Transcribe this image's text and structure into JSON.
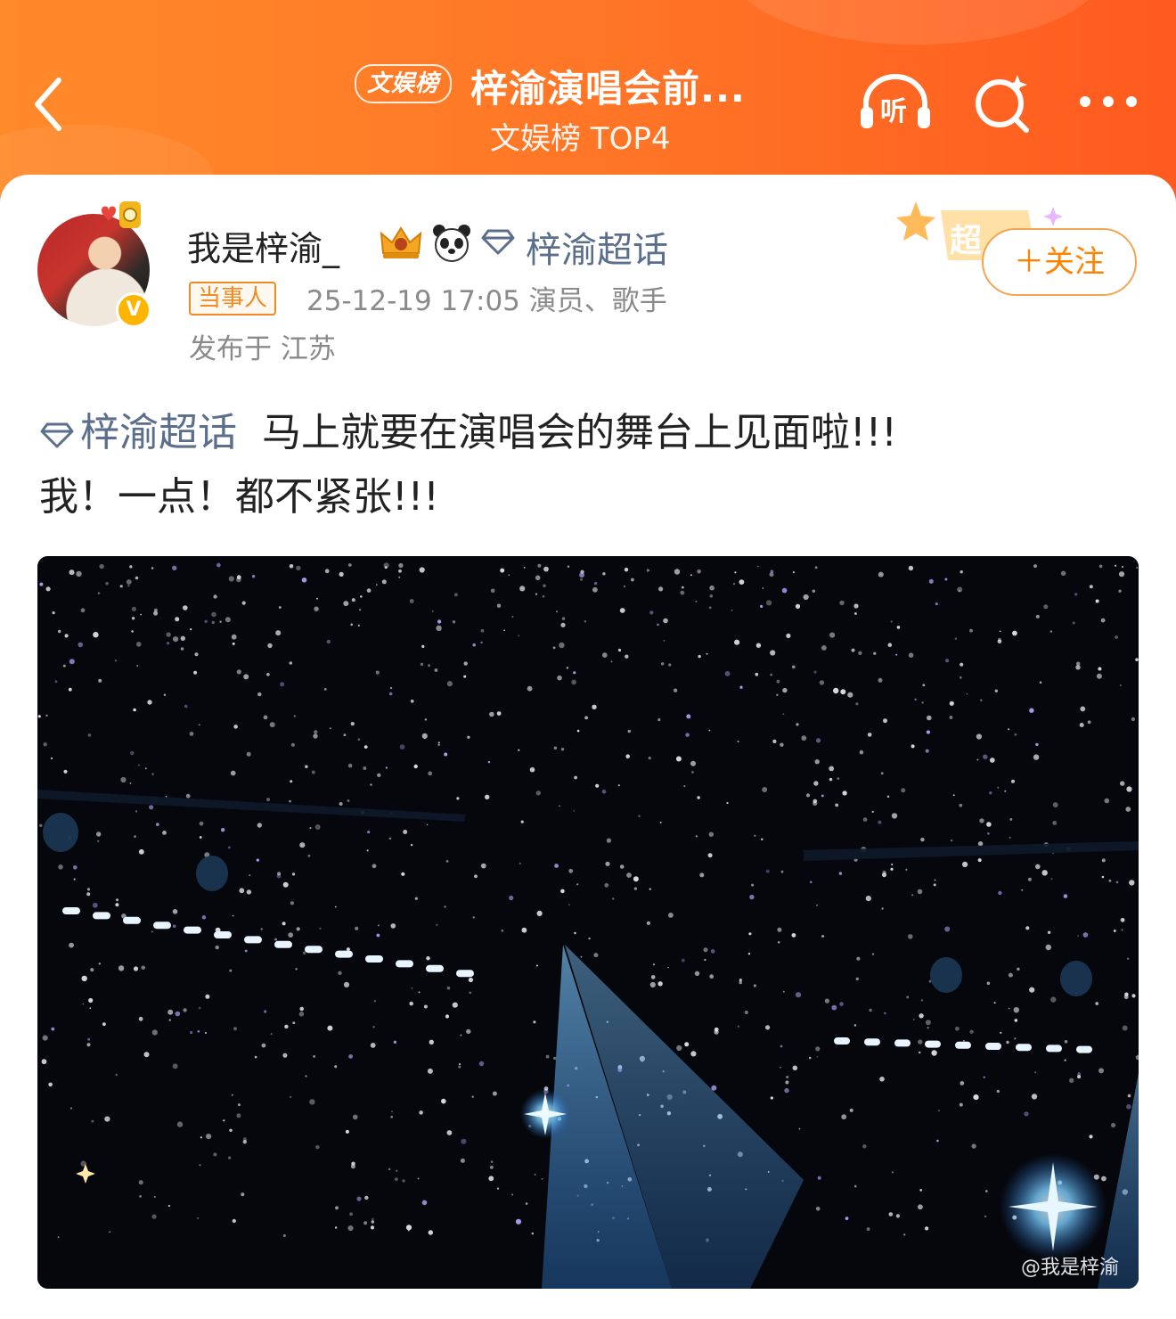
{
  "header": {
    "rank_badge": "文娱榜",
    "topic_title": "梓渝演唱会前...",
    "topic_subtitle": "文娱榜 TOP4",
    "listen_label": "听"
  },
  "post": {
    "username": "我是梓渝_",
    "super_topic": "梓渝超话",
    "party_tag": "当事人",
    "meta": "25-12-19 17:05  演员、歌手",
    "location": "发布于 江苏",
    "follow_label": "＋关注",
    "super_badge_label": "超",
    "verified_badge": "V",
    "text_topic": "梓渝超话",
    "text_line1": "马上就要在演唱会的舞台上见面啦!!!",
    "text_line2": "我！一点！都不紧张!!!",
    "image_watermark": "@我是梓渝"
  },
  "colors": {
    "header_orange": "#ff7426",
    "topic_link": "#5b6e8c",
    "follow_orange": "#ff8200",
    "tag_orange": "#f08a24"
  },
  "icons": [
    "back-arrow-icon",
    "listen-headphone-icon",
    "search-sparkle-icon",
    "more-dots-icon",
    "crown-icon",
    "panda-icon",
    "diamond-icon",
    "verified-v-icon"
  ]
}
